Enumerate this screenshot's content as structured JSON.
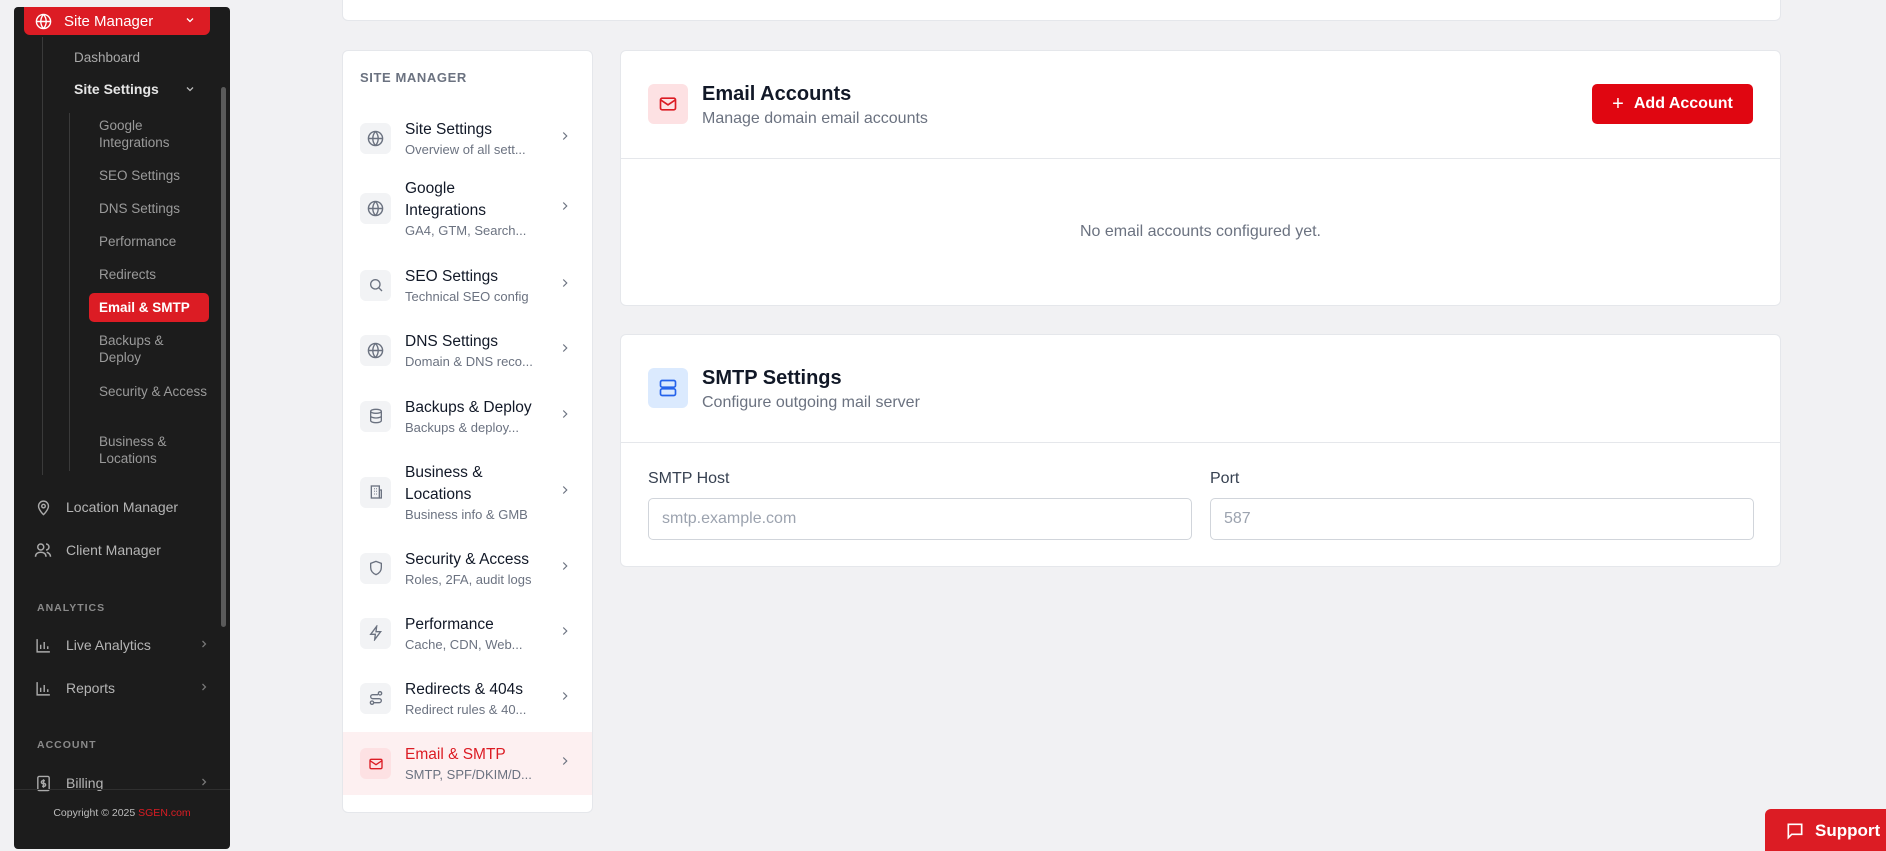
{
  "sidebar": {
    "site_manager": "Site Manager",
    "dashboard": "Dashboard",
    "site_settings": "Site Settings",
    "sub_items": [
      "Google Integrations",
      "SEO Settings",
      "DNS Settings",
      "Performance",
      "Redirects",
      "Email & SMTP",
      "Backups & Deploy",
      "Security & Access",
      "Business & Locations"
    ],
    "location_manager": "Location Manager",
    "client_manager": "Client Manager",
    "section_analytics": "ANALYTICS",
    "live_analytics": "Live Analytics",
    "reports": "Reports",
    "section_account": "ACCOUNT",
    "billing": "Billing",
    "copyright": "Copyright © 2025",
    "brand": "SGEN.com"
  },
  "nav": {
    "heading": "SITE MANAGER",
    "items": [
      {
        "title": "Site Settings",
        "desc": "Overview of all sett...",
        "icon": "globe-icon"
      },
      {
        "title": "Google Integrations",
        "desc": "GA4, GTM, Search...",
        "icon": "globe-icon"
      },
      {
        "title": "SEO Settings",
        "desc": "Technical SEO config",
        "icon": "search-icon"
      },
      {
        "title": "DNS Settings",
        "desc": "Domain & DNS reco...",
        "icon": "globe-icon"
      },
      {
        "title": "Backups & Deploy",
        "desc": "Backups & deploy...",
        "icon": "database-icon"
      },
      {
        "title": "Business & Locations",
        "desc": "Business info & GMB",
        "icon": "building-icon"
      },
      {
        "title": "Security & Access",
        "desc": "Roles, 2FA, audit logs",
        "icon": "shield-icon"
      },
      {
        "title": "Performance",
        "desc": "Cache, CDN, Web...",
        "icon": "bolt-icon"
      },
      {
        "title": "Redirects & 404s",
        "desc": "Redirect rules & 40...",
        "icon": "route-icon"
      },
      {
        "title": "Email & SMTP",
        "desc": "SMTP, SPF/DKIM/D...",
        "icon": "mail-icon"
      }
    ]
  },
  "email_accounts": {
    "title": "Email Accounts",
    "subtitle": "Manage domain email accounts",
    "add_button": "Add Account",
    "empty": "No email accounts configured yet."
  },
  "smtp": {
    "title": "SMTP Settings",
    "subtitle": "Configure outgoing mail server",
    "host_label": "SMTP Host",
    "host_placeholder": "smtp.example.com",
    "port_label": "Port",
    "port_placeholder": "587"
  },
  "support_label": "Support",
  "colors": {
    "accent": "#dc1c24",
    "sidebar_bg": "#1c1c1c"
  }
}
